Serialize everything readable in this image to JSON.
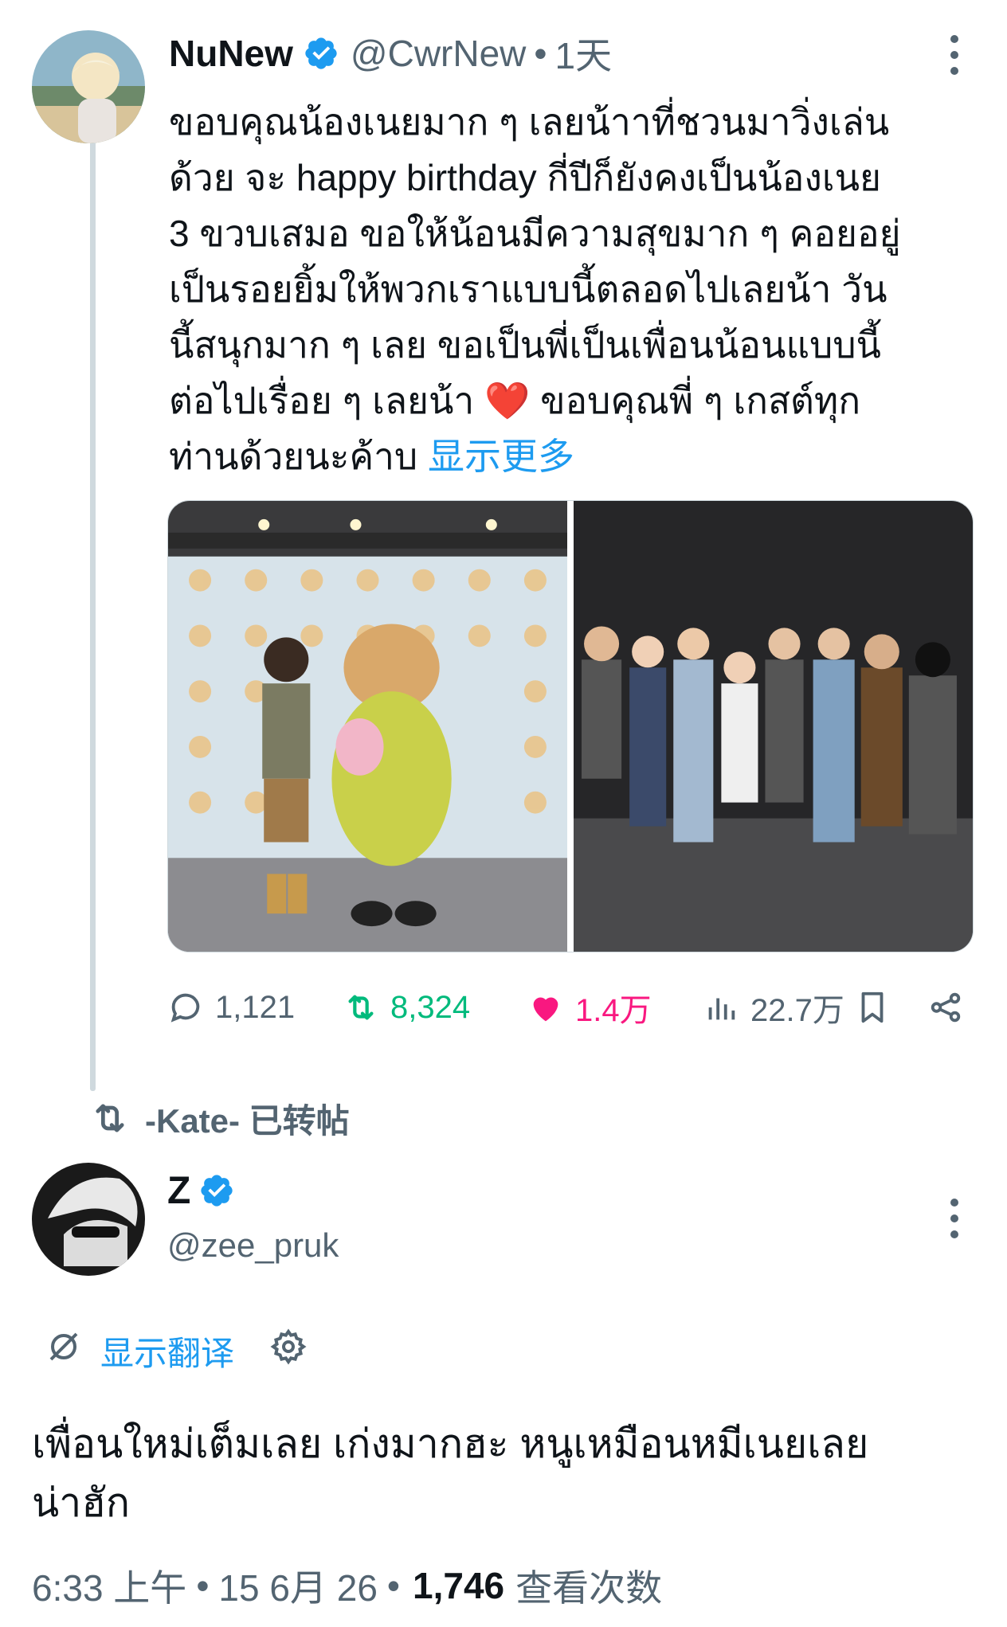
{
  "tweet1": {
    "author_name": "NuNew",
    "handle": "@CwrNew",
    "separator": "•",
    "time": "1天",
    "text_lines": [
      "ขอบคุณน้องเนยมาก ๆ เลยน้าาที่ชวนมาวิ่งเล่น",
      "ด้วย จะ happy birthday กี่ปีก็ยังคงเป็นน้องเนย",
      "3 ขวบเสมอ ขอให้น้อนมีความสุขมาก ๆ คอยอยู่",
      "เป็นรอยยิ้มให้พวกเราแบบนี้ตลอดไปเลยน้า วัน",
      "นี้สนุกมาก ๆ เลย ขอเป็นพี่เป็นเพื่อนน้อนแบบนี้",
      "ต่อไปเรื่อย ๆ เลยน้า ❤️ ขอบคุณพี่ ๆ เกสต์ทุก",
      "ท่านด้วยนะค้าบ"
    ],
    "show_more": "显示更多",
    "actions": {
      "replies": "1,121",
      "reposts": "8,324",
      "likes": "1.4万",
      "views": "22.7万"
    },
    "colors": {
      "repost": "#00ba7c",
      "like": "#f91880",
      "link": "#1d9bf0",
      "muted": "#536471"
    }
  },
  "retweet": {
    "label": "-Kate- 已转帖"
  },
  "tweet2": {
    "author_name": "Z",
    "handle": "@zee_pruk",
    "translate_label": "显示翻译",
    "text_lines": [
      "เพื่อนใหม่เต็มเลย เก่งมากฮะ หนูเหมือนหมีเนยเลย",
      "น่าฮัก"
    ],
    "time": "6:33 上午",
    "date": "15 6月 26",
    "separator": "•",
    "views_count": "1,746",
    "views_label": "查看次数"
  }
}
